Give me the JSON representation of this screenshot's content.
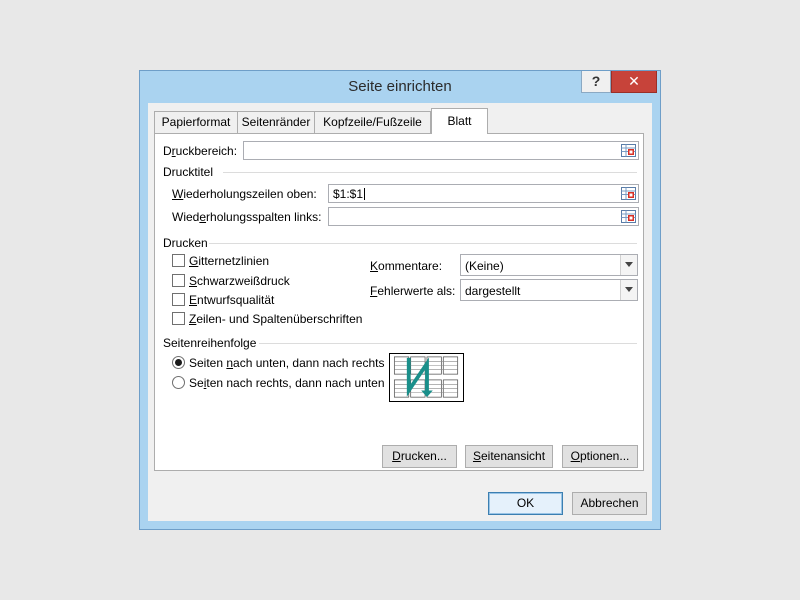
{
  "dialog": {
    "title": "Seite einrichten",
    "help_label": "?",
    "close_label": "✕"
  },
  "tabs": [
    {
      "label": "Papierformat",
      "active": false
    },
    {
      "label": "Seitenränder",
      "active": false
    },
    {
      "label": "Kopfzeile/Fußzeile",
      "active": false
    },
    {
      "label": "Blatt",
      "active": true
    }
  ],
  "print_area": {
    "label_pre": "D",
    "label_u": "r",
    "label_post": "uckbereich:",
    "value": ""
  },
  "print_titles": {
    "section": "Drucktitel",
    "rows_label_pre": "",
    "rows_label_u": "W",
    "rows_label_post": "iederholungszeilen oben:",
    "rows_value": "$1:$1",
    "cols_label_pre": "Wied",
    "cols_label_u": "e",
    "cols_label_post": "rholungsspalten links:",
    "cols_value": ""
  },
  "print": {
    "section": "Drucken",
    "checkboxes": [
      {
        "u": "G",
        "rest": "itternetzlinien",
        "checked": false
      },
      {
        "u": "S",
        "rest": "chwarzweißdruck",
        "checked": false
      },
      {
        "u": "E",
        "rest": "ntwurfsqualität",
        "checked": false
      },
      {
        "u": "Z",
        "rest": "eilen- und Spaltenüberschriften",
        "checked": false
      }
    ],
    "comments_label_pre": "",
    "comments_label_u": "K",
    "comments_label_post": "ommentare:",
    "comments_value": "(Keine)",
    "errors_label_pre": "",
    "errors_label_u": "F",
    "errors_label_post": "ehlerwerte als:",
    "errors_value": "dargestellt"
  },
  "page_order": {
    "section": "Seitenreihenfolge",
    "option1_pre": "Seiten ",
    "option1_u": "n",
    "option1_post": "ach unten, dann nach rechts",
    "option2_pre": "Se",
    "option2_u": "i",
    "option2_post": "ten nach rechts, dann nach unten",
    "selected": 1
  },
  "buttons": {
    "print_pre": "",
    "print_u": "D",
    "print_post": "rucken...",
    "preview_pre": "",
    "preview_u": "S",
    "preview_post": "eitenansicht",
    "options_pre": "",
    "options_u": "O",
    "options_post": "ptionen...",
    "ok": "OK",
    "cancel": "Abbrechen"
  },
  "colors": {
    "title_bg": "#aad3f0",
    "close_bg": "#c7433a",
    "order_arrow": "#1a8f8a"
  }
}
